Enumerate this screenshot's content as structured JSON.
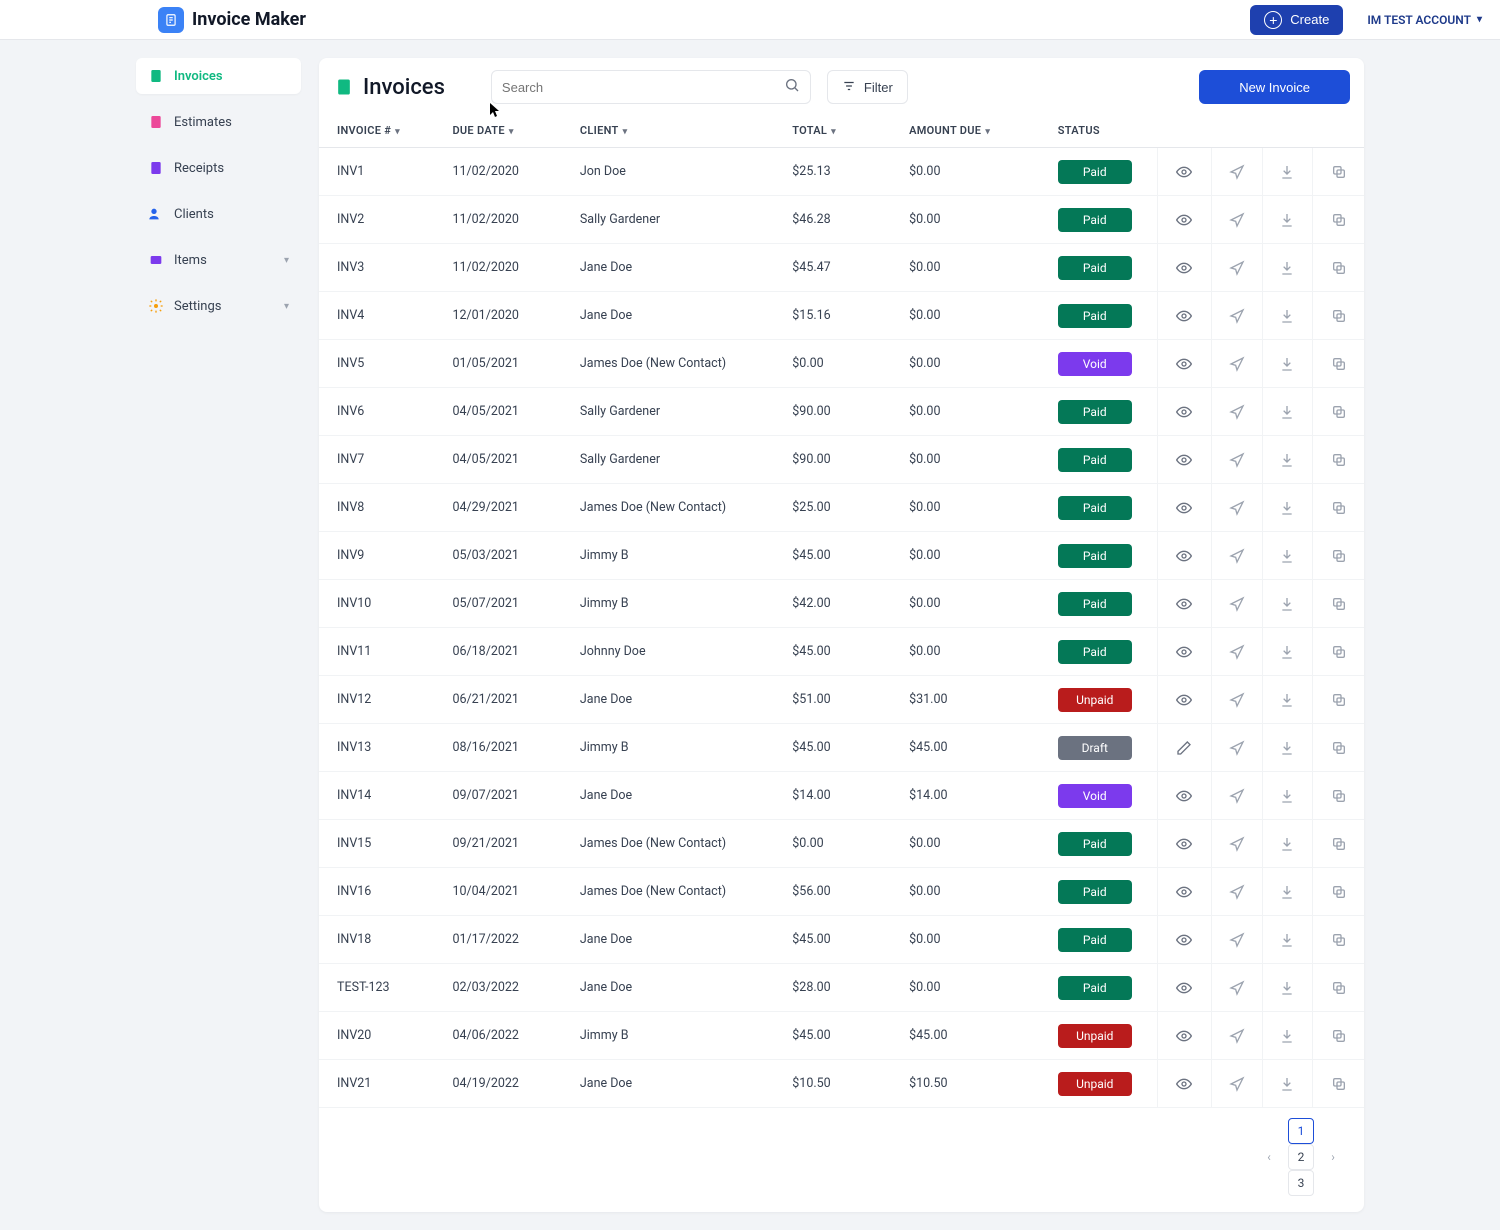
{
  "brand": {
    "name": "Invoice Maker"
  },
  "topbar": {
    "create_label": "Create",
    "account_label": "IM TEST ACCOUNT"
  },
  "sidebar": {
    "items": [
      {
        "label": "Invoices"
      },
      {
        "label": "Estimates"
      },
      {
        "label": "Receipts"
      },
      {
        "label": "Clients"
      },
      {
        "label": "Items"
      },
      {
        "label": "Settings"
      }
    ]
  },
  "page": {
    "title": "Invoices",
    "search_placeholder": "Search",
    "filter_label": "Filter",
    "new_invoice_label": "New Invoice"
  },
  "columns": {
    "invoice": "INVOICE #",
    "due_date": "DUE DATE",
    "client": "CLIENT",
    "total": "TOTAL",
    "amount_due": "AMOUNT DUE",
    "status": "STATUS"
  },
  "rows": [
    {
      "inv": "INV1",
      "date": "11/02/2020",
      "client": "Jon Doe",
      "total": "$25.13",
      "due": "$0.00",
      "status": "Paid"
    },
    {
      "inv": "INV2",
      "date": "11/02/2020",
      "client": "Sally Gardener",
      "total": "$46.28",
      "due": "$0.00",
      "status": "Paid"
    },
    {
      "inv": "INV3",
      "date": "11/02/2020",
      "client": "Jane Doe",
      "total": "$45.47",
      "due": "$0.00",
      "status": "Paid"
    },
    {
      "inv": "INV4",
      "date": "12/01/2020",
      "client": "Jane Doe",
      "total": "$15.16",
      "due": "$0.00",
      "status": "Paid"
    },
    {
      "inv": "INV5",
      "date": "01/05/2021",
      "client": "James Doe (New Contact)",
      "total": "$0.00",
      "due": "$0.00",
      "status": "Void"
    },
    {
      "inv": "INV6",
      "date": "04/05/2021",
      "client": "Sally Gardener",
      "total": "$90.00",
      "due": "$0.00",
      "status": "Paid"
    },
    {
      "inv": "INV7",
      "date": "04/05/2021",
      "client": "Sally Gardener",
      "total": "$90.00",
      "due": "$0.00",
      "status": "Paid"
    },
    {
      "inv": "INV8",
      "date": "04/29/2021",
      "client": "James Doe (New Contact)",
      "total": "$25.00",
      "due": "$0.00",
      "status": "Paid"
    },
    {
      "inv": "INV9",
      "date": "05/03/2021",
      "client": "Jimmy B",
      "total": "$45.00",
      "due": "$0.00",
      "status": "Paid"
    },
    {
      "inv": "INV10",
      "date": "05/07/2021",
      "client": "Jimmy B",
      "total": "$42.00",
      "due": "$0.00",
      "status": "Paid"
    },
    {
      "inv": "INV11",
      "date": "06/18/2021",
      "client": "Johnny Doe",
      "total": "$45.00",
      "due": "$0.00",
      "status": "Paid"
    },
    {
      "inv": "INV12",
      "date": "06/21/2021",
      "client": "Jane Doe",
      "total": "$51.00",
      "due": "$31.00",
      "status": "Unpaid"
    },
    {
      "inv": "INV13",
      "date": "08/16/2021",
      "client": "Jimmy B",
      "total": "$45.00",
      "due": "$45.00",
      "status": "Draft"
    },
    {
      "inv": "INV14",
      "date": "09/07/2021",
      "client": "Jane Doe",
      "total": "$14.00",
      "due": "$14.00",
      "status": "Void"
    },
    {
      "inv": "INV15",
      "date": "09/21/2021",
      "client": "James Doe (New Contact)",
      "total": "$0.00",
      "due": "$0.00",
      "status": "Paid"
    },
    {
      "inv": "INV16",
      "date": "10/04/2021",
      "client": "James Doe (New Contact)",
      "total": "$56.00",
      "due": "$0.00",
      "status": "Paid"
    },
    {
      "inv": "INV18",
      "date": "01/17/2022",
      "client": "Jane Doe",
      "total": "$45.00",
      "due": "$0.00",
      "status": "Paid"
    },
    {
      "inv": "TEST-123",
      "date": "02/03/2022",
      "client": "Jane Doe",
      "total": "$28.00",
      "due": "$0.00",
      "status": "Paid"
    },
    {
      "inv": "INV20",
      "date": "04/06/2022",
      "client": "Jimmy B",
      "total": "$45.00",
      "due": "$45.00",
      "status": "Unpaid"
    },
    {
      "inv": "INV21",
      "date": "04/19/2022",
      "client": "Jane Doe",
      "total": "$10.50",
      "due": "$10.50",
      "status": "Unpaid"
    }
  ],
  "pagination": {
    "pages": [
      "1",
      "2",
      "3"
    ],
    "active": "1"
  }
}
